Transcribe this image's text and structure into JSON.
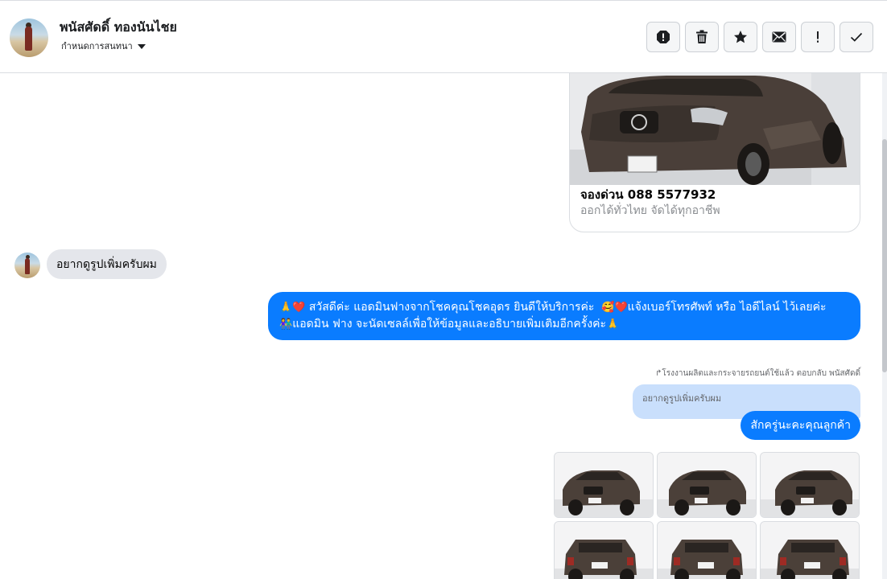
{
  "header": {
    "contact_name": "พนัสศัดดิ์ ทองนันไชย",
    "subtitle": "กำหนดการสนทนา",
    "tools": [
      {
        "name": "report-icon",
        "label": "!"
      },
      {
        "name": "trash-icon"
      },
      {
        "name": "star-icon"
      },
      {
        "name": "envelope-icon"
      },
      {
        "name": "exclamation-icon",
        "label": "!"
      },
      {
        "name": "check-icon"
      }
    ]
  },
  "thread": {
    "card": {
      "title": "จองด่วน 088 5577932",
      "subtitle": "ออกได้ทั่วไทย จัดได้ทุกอาชีพ"
    },
    "incoming": {
      "text": "อยากดูรูปเพิ่มครับผม"
    },
    "outgoing": {
      "line1": "สวัสดีค่ะ แอดมินฟางจากโชคคุณโชคอุดร ยินดีให้บริการค่ะ",
      "line1b": "แจ้งเบอร์โทรศัพท์ หรือ ไอดีไลน์  ไว้เลยค่ะ",
      "line2": "แอดมิน ฟาง จะนัดเซลล์เพื่อให้ข้อมูลและอธิบายเพิ่มเติมอีกครั้งค่ะ"
    },
    "reply_meta": "โรงงานผลิตและกระจายรถยนต์ใช้แล้ว ตอบกลับ พนัสศัดดิ์",
    "quoted": "อยากดูรูปเพิ่มครับผม",
    "reply": "สักครู่นะคะคุณลูกค้า",
    "photo_count": 6
  },
  "colors": {
    "accent": "#0a7cff",
    "incoming_bg": "#e4e6eb",
    "quoted_bg": "#c9dffc",
    "border": "#dadde1"
  }
}
